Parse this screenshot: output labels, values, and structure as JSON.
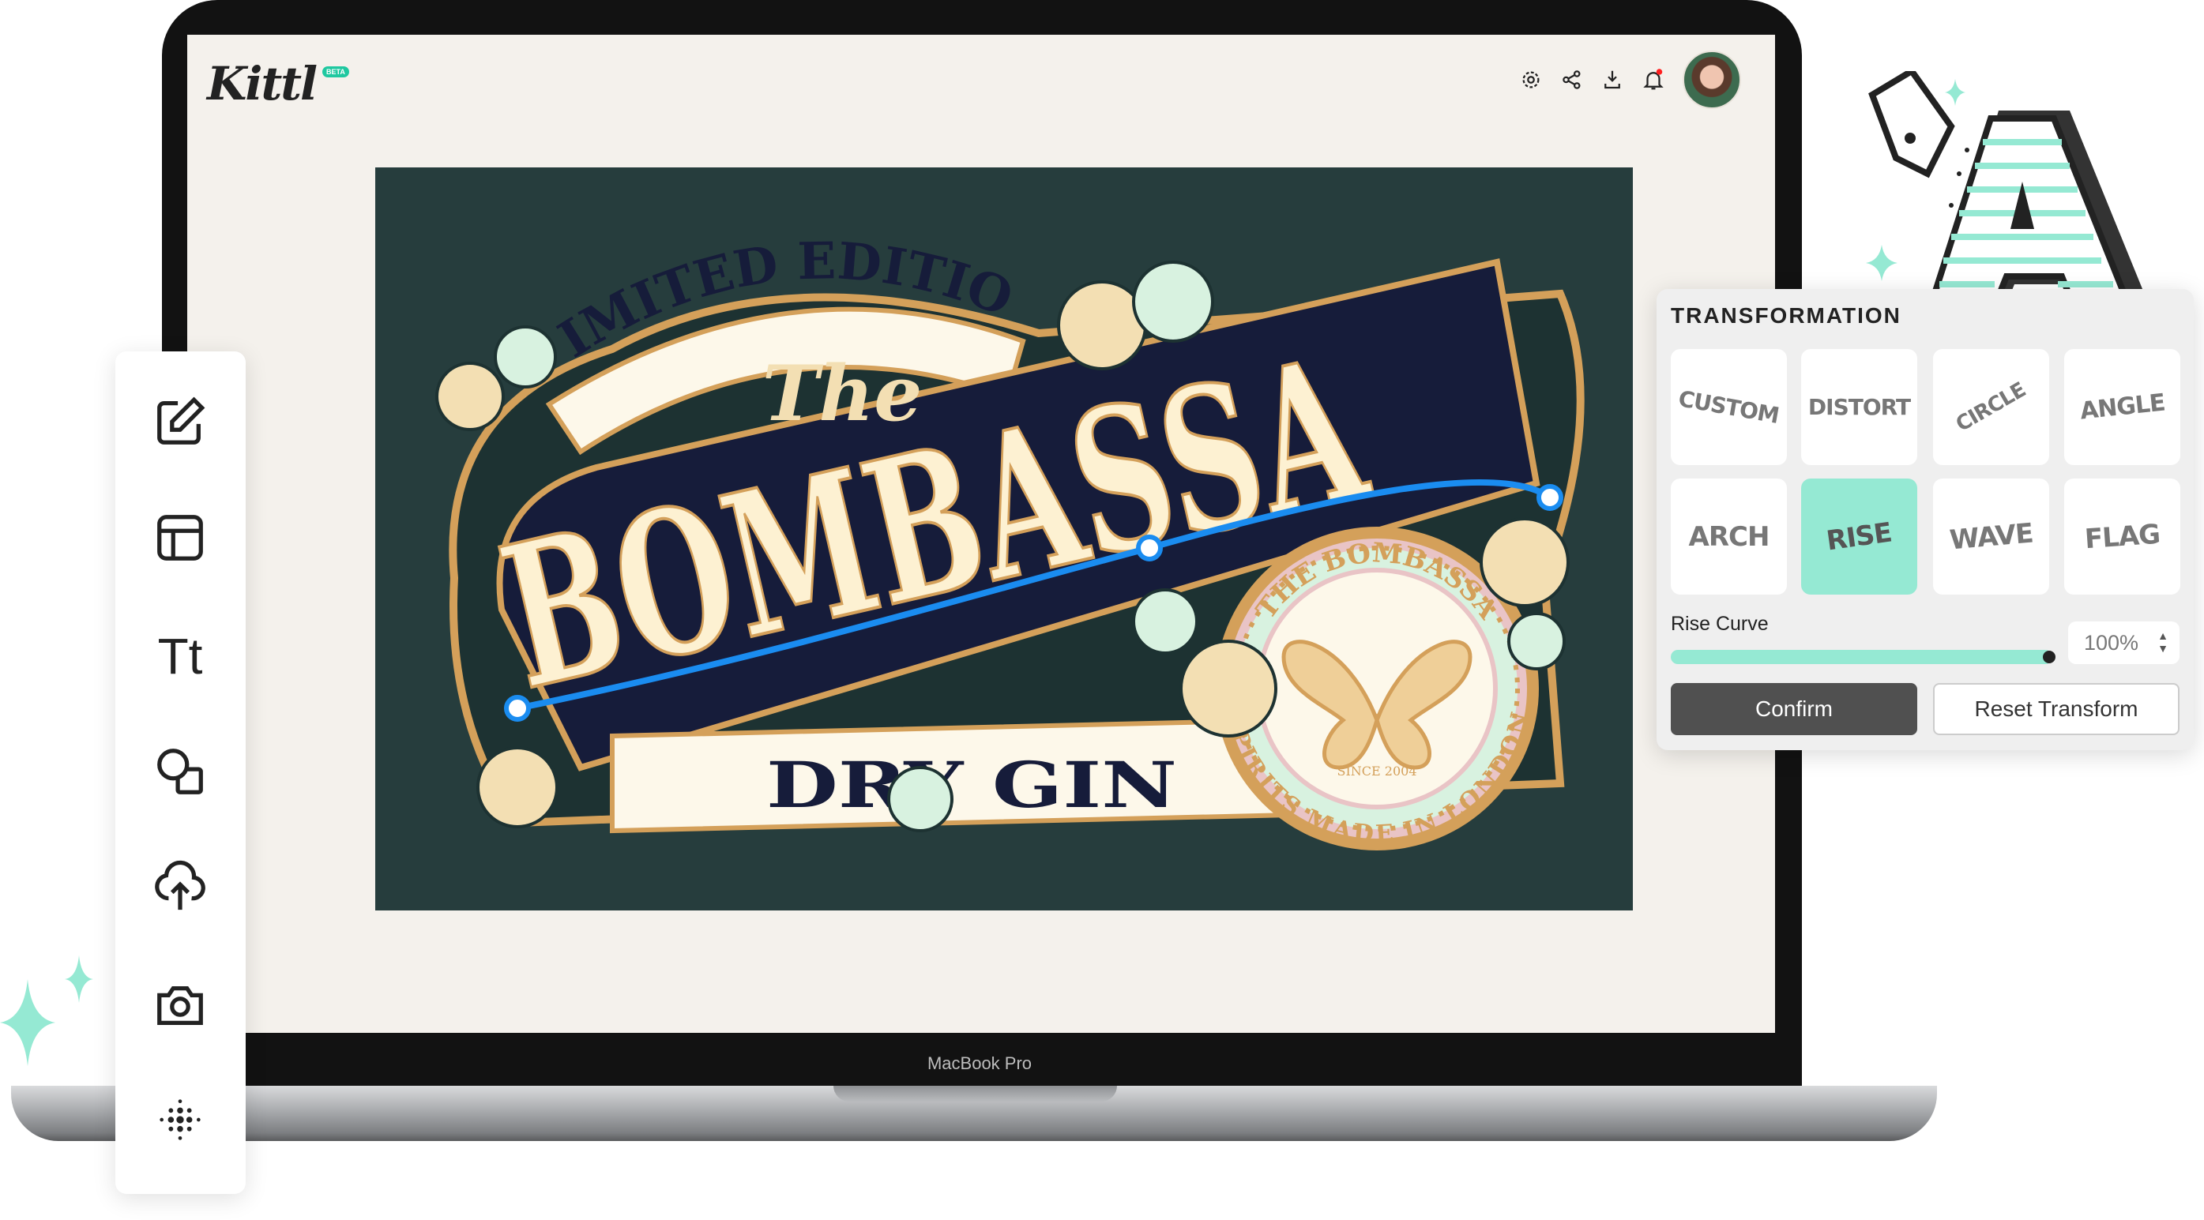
{
  "app": {
    "logo": "Kittl",
    "badge": "BETA"
  },
  "header": {
    "icons": [
      "gear-icon",
      "share-icon",
      "download-icon",
      "bell-icon"
    ],
    "notification_dot_color": "#ff2020"
  },
  "device": {
    "label": "MacBook Pro"
  },
  "toolbar": {
    "items": [
      {
        "name": "edit"
      },
      {
        "name": "layout"
      },
      {
        "name": "text"
      },
      {
        "name": "shapes"
      },
      {
        "name": "upload"
      },
      {
        "name": "camera"
      },
      {
        "name": "pattern"
      }
    ]
  },
  "artwork": {
    "top_banner": "LIMITED EDITION",
    "script": "The",
    "title": "BOMBASSA",
    "subtitle": "DRY GIN",
    "badge_top": "THE BOMBASSA",
    "badge_bottom": "SPIRITS MADE IN LONDON",
    "badge_since": "SINCE 2004",
    "colors": {
      "background": "#263d3d",
      "cream": "#fdf8ea",
      "gold": "#d4a05a",
      "navy": "#161c3a",
      "curve": "#1a8cf0"
    }
  },
  "panel": {
    "title": "TRANSFORMATION",
    "options": [
      {
        "label": "CUSTOM"
      },
      {
        "label": "DISTORT"
      },
      {
        "label": "CIRCLE"
      },
      {
        "label": "ANGLE"
      },
      {
        "label": "ARCH"
      },
      {
        "label": "RISE",
        "active": true
      },
      {
        "label": "WAVE"
      },
      {
        "label": "FLAG"
      }
    ],
    "curve_label": "Rise Curve",
    "curve_value": "100%",
    "curve_fraction": 1.0,
    "confirm": "Confirm",
    "reset": "Reset Transform",
    "accent": "#95e9d3"
  }
}
